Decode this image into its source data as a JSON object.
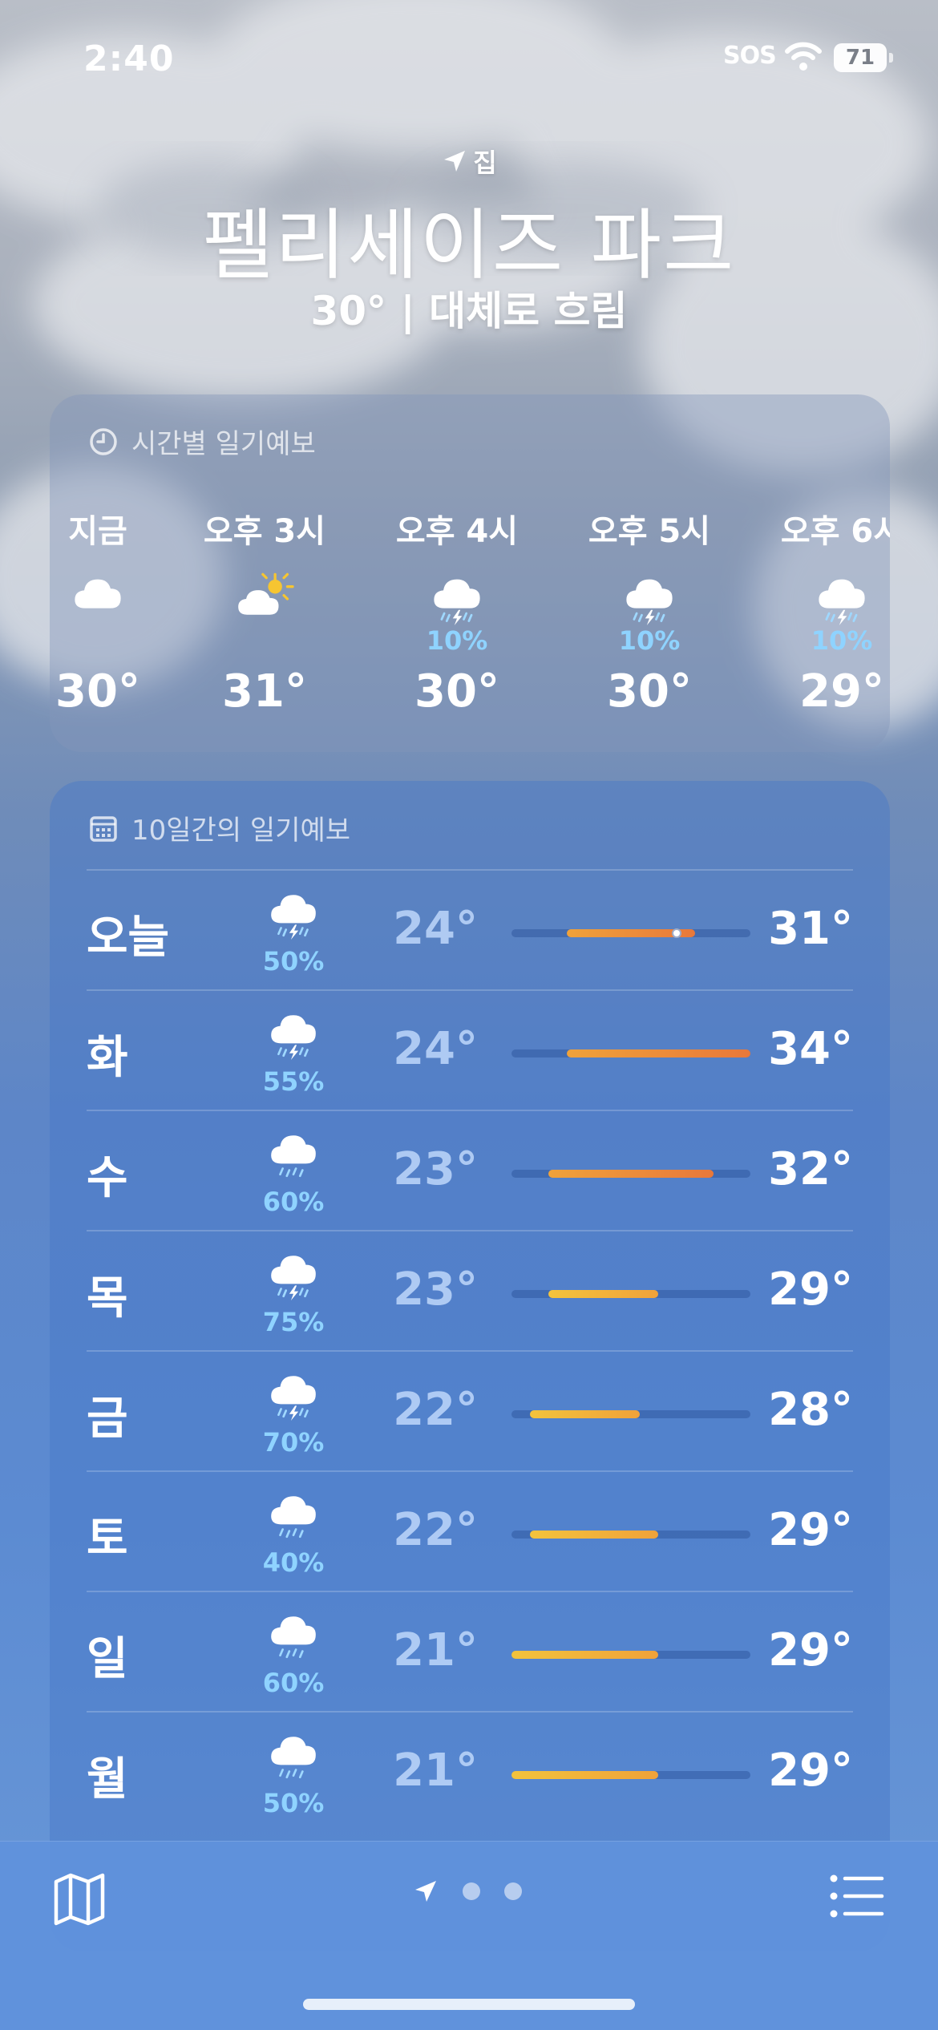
{
  "status_bar": {
    "time": "2:40",
    "sos": "SOS",
    "battery": "71"
  },
  "header": {
    "location_label": "집",
    "city": "펠리세이즈 파크",
    "summary": "30° | 대체로 흐림"
  },
  "hourly": {
    "title": "시간별 일기예보",
    "icon": "clock-icon",
    "items": [
      {
        "label": "지금",
        "icon": "cloud-icon",
        "pct": "",
        "temp": "30°"
      },
      {
        "label": "오후 3시",
        "icon": "partly-sunny-icon",
        "pct": "",
        "temp": "31°"
      },
      {
        "label": "오후 4시",
        "icon": "thunderstorm-icon",
        "pct": "10%",
        "temp": "30°"
      },
      {
        "label": "오후 5시",
        "icon": "thunderstorm-icon",
        "pct": "10%",
        "temp": "30°"
      },
      {
        "label": "오후 6시",
        "icon": "thunderstorm-icon",
        "pct": "10%",
        "temp": "29°"
      }
    ]
  },
  "daily": {
    "title": "10일간의 일기예보",
    "icon": "calendar-icon",
    "range_min": 21,
    "range_max": 34,
    "days": [
      {
        "name": "오늘",
        "icon": "thunderstorm-icon",
        "pct": "50%",
        "low": "24°",
        "high": "31°",
        "low_val": 24,
        "high_val": 31,
        "current_val": 30
      },
      {
        "name": "화",
        "icon": "thunderstorm-icon",
        "pct": "55%",
        "low": "24°",
        "high": "34°",
        "low_val": 24,
        "high_val": 34
      },
      {
        "name": "수",
        "icon": "rain-icon",
        "pct": "60%",
        "low": "23°",
        "high": "32°",
        "low_val": 23,
        "high_val": 32
      },
      {
        "name": "목",
        "icon": "thunderstorm-icon",
        "pct": "75%",
        "low": "23°",
        "high": "29°",
        "low_val": 23,
        "high_val": 29
      },
      {
        "name": "금",
        "icon": "thunderstorm-icon",
        "pct": "70%",
        "low": "22°",
        "high": "28°",
        "low_val": 22,
        "high_val": 28
      },
      {
        "name": "토",
        "icon": "rain-icon",
        "pct": "40%",
        "low": "22°",
        "high": "29°",
        "low_val": 22,
        "high_val": 29
      },
      {
        "name": "일",
        "icon": "rain-icon",
        "pct": "60%",
        "low": "21°",
        "high": "29°",
        "low_val": 21,
        "high_val": 29
      },
      {
        "name": "월",
        "icon": "rain-icon",
        "pct": "50%",
        "low": "21°",
        "high": "29°",
        "low_val": 21,
        "high_val": 29
      }
    ]
  },
  "toolbar": {
    "map_icon": "map-icon",
    "location_icon": "location-arrow-icon",
    "list_icon": "list-icon",
    "page_count": 3
  },
  "colors": {
    "precip": "#8fd3ff",
    "bar_warm": "#f0a23a",
    "bar_hot": "#e8783a",
    "bar_cool": "#f3c33c"
  }
}
